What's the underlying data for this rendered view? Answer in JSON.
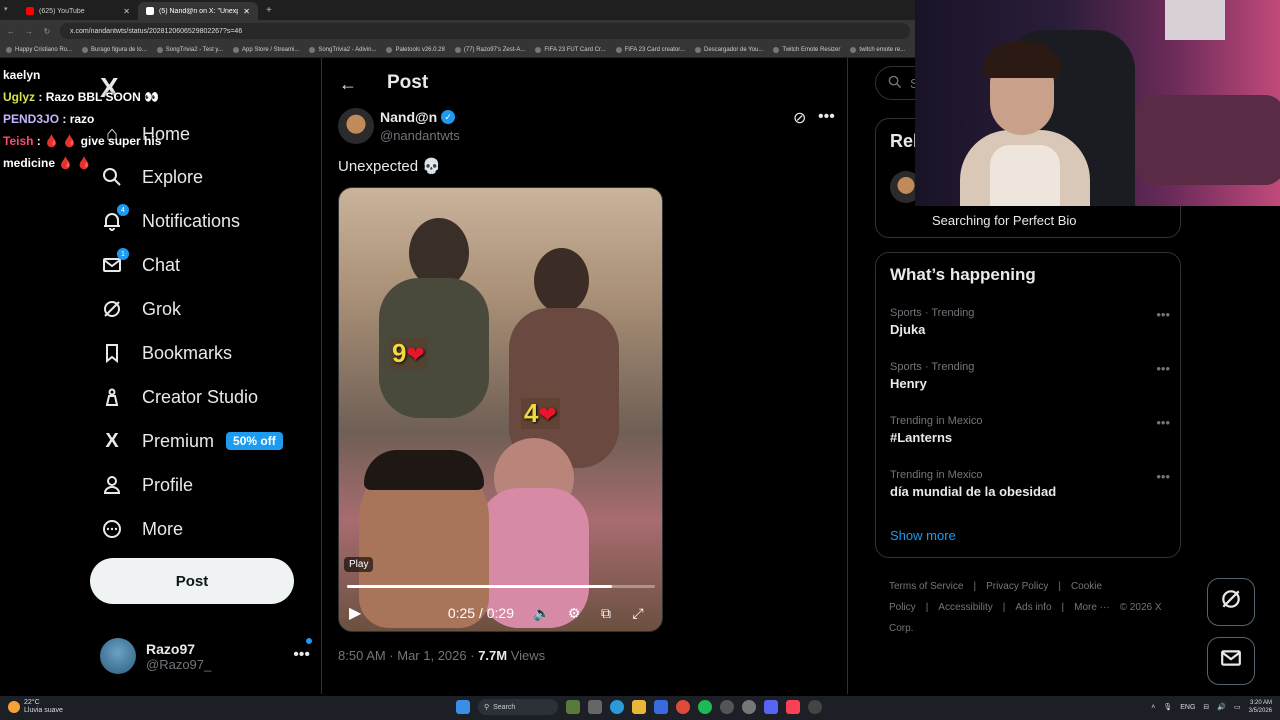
{
  "browser": {
    "tabs": [
      {
        "title": "(625) YouTube",
        "active": false,
        "color": "#ff0000"
      },
      {
        "title": "(5) Nand@n on X: \"Unexpe...",
        "active": true,
        "color": "#ffffff"
      }
    ],
    "new_tab": "+",
    "url": "x.com/nandantwts/status/2028120606529802267?s=46",
    "bookmarks": [
      "Happy Cristiano Ro...",
      "Burago figura de lo...",
      "SongTrivia2 - Test y...",
      "App Store / Streami...",
      "SongTrivia2 - Adivin...",
      "Paletools v26.0.28",
      "(77) Razo97's Zest-A...",
      "FIFA 23 FUT Card Cr...",
      "FIFA 23 Card creator...",
      "Descargador de You...",
      "Twitch Emote Resizer",
      "twitch emote re..."
    ]
  },
  "chat": [
    {
      "user": "kaelyn",
      "text": ""
    },
    {
      "user": "Uglyz",
      "text": "Razo BBL SOON 👀"
    },
    {
      "user": "PEND3JO",
      "text": "razo"
    },
    {
      "user": "Teish",
      "text": "🩸 🩸 give super his"
    },
    {
      "user": "",
      "text": "medicine 🩸 🩸"
    }
  ],
  "sidebar": {
    "logo": "X",
    "items": [
      {
        "label": "Home",
        "icon": "home-icon",
        "glyph": "⌂"
      },
      {
        "label": "Explore",
        "icon": "search-icon",
        "glyph": "⚲"
      },
      {
        "label": "Notifications",
        "icon": "bell-icon",
        "glyph": "🔔",
        "badge": "4"
      },
      {
        "label": "Chat",
        "icon": "mail-icon",
        "glyph": "✉",
        "badge": "1"
      },
      {
        "label": "Grok",
        "icon": "grok-icon",
        "glyph": "⊘"
      },
      {
        "label": "Bookmarks",
        "icon": "bookmark-icon",
        "glyph": "🔖"
      },
      {
        "label": "Creator Studio",
        "icon": "creator-studio-icon",
        "glyph": "♙"
      },
      {
        "label": "Premium",
        "icon": "x-premium-icon",
        "glyph": "𝕏",
        "promo": "50% off"
      },
      {
        "label": "Profile",
        "icon": "person-icon",
        "glyph": "👤"
      },
      {
        "label": "More",
        "icon": "more-circle-icon",
        "glyph": "⋯"
      }
    ],
    "post_button": "Post",
    "account": {
      "name": "Razo97",
      "handle": "@Razo97_",
      "more": "•••"
    }
  },
  "main": {
    "back": "←",
    "title": "Post",
    "author": {
      "name": "Nand@n",
      "handle": "@nandantwts",
      "verified": "✓"
    },
    "more": "•••",
    "text": "Unexpected 💀",
    "video": {
      "overlay_1": "9",
      "overlay_2": "4",
      "heart": "❤",
      "play_tag": "Play",
      "time": "0:25 / 0:29",
      "progress": 0.86
    },
    "meta": {
      "time": "8:50 AM · Mar 1, 2026 · ",
      "views_count": "7.7M",
      "views_label": " Views"
    }
  },
  "right": {
    "search_placeholder": "Se",
    "relevant_title": "Rel",
    "relevant_bio": "Searching for Perfect Bio",
    "happening_title": "What’s happening",
    "trends": [
      {
        "category": "Sports · Trending",
        "name": "Djuka"
      },
      {
        "category": "Sports · Trending",
        "name": "Henry"
      },
      {
        "category": "Trending in Mexico",
        "name": "#Lanterns"
      },
      {
        "category": "Trending in Mexico",
        "name": "día mundial de la obesidad"
      }
    ],
    "trend_more": "•••",
    "show_more": "Show more",
    "footer": [
      "Terms of Service",
      "|",
      "Privacy Policy",
      "|",
      "Cookie Policy",
      "|",
      "Accessibility",
      "|",
      "Ads info",
      "|",
      "More ···",
      "© 2026 X Corp."
    ]
  },
  "taskbar": {
    "weather_temp": "22°C",
    "weather_desc": "Lluvia suave",
    "search": "Search",
    "lang": "ENG",
    "time": "3:20 AM",
    "date": "3/5/2026"
  }
}
